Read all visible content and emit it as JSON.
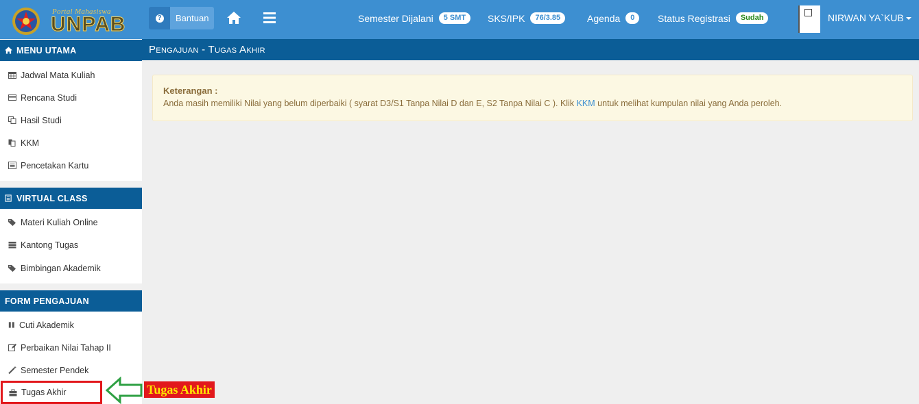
{
  "brand": {
    "small": "Portal Mahasiswa",
    "big": "UNPAB"
  },
  "header": {
    "help_label": "Bantuan",
    "semester_label": "Semester Dijalani",
    "semester_value": "5 SMT",
    "sks_label": "SKS/IPK",
    "sks_value": "76/3.85",
    "agenda_label": "Agenda",
    "agenda_value": "0",
    "registration_label": "Status Registrasi",
    "registration_value": "Sudah",
    "user_name": "NIRWAN YA`KUB"
  },
  "sidebar": {
    "menu_utama": {
      "title": "MENU UTAMA",
      "items": [
        {
          "label": "Jadwal Mata Kuliah",
          "icon": "calendar-icon"
        },
        {
          "label": "Rencana Studi",
          "icon": "credit-card-icon"
        },
        {
          "label": "Hasil Studi",
          "icon": "copy-icon"
        },
        {
          "label": "KKM",
          "icon": "documents-icon"
        },
        {
          "label": "Pencetakan Kartu",
          "icon": "list-alt-icon"
        }
      ]
    },
    "virtual_class": {
      "title": "VIRTUAL CLASS",
      "items": [
        {
          "label": "Materi Kuliah Online",
          "icon": "tags-icon"
        },
        {
          "label": "Kantong Tugas",
          "icon": "tasks-icon"
        },
        {
          "label": "Bimbingan Akademik",
          "icon": "tags-icon"
        }
      ]
    },
    "form_pengajuan": {
      "title": "FORM PENGAJUAN",
      "items": [
        {
          "label": "Cuti Akademik",
          "icon": "pause-icon"
        },
        {
          "label": "Perbaikan Nilai Tahap II",
          "icon": "edit-icon"
        },
        {
          "label": "Semester Pendek",
          "icon": "magic-wand-icon"
        },
        {
          "label": "Tugas Akhir",
          "icon": "briefcase-icon"
        }
      ]
    }
  },
  "page": {
    "title": "Pengajuan - Tugas Akhir"
  },
  "alert": {
    "title": "Keterangan :",
    "text_before": "Anda masih memiliki Nilai yang belum diperbaiki ( syarat D3/S1 Tanpa Nilai D dan E, S2 Tanpa Nilai C ). Klik ",
    "link": "KKM",
    "text_after": " untuk melihat kumpulan nilai yang Anda peroleh."
  },
  "annotation": {
    "label": "Tugas Akhir"
  },
  "colors": {
    "navbar": "#3d8fd1",
    "section_header": "#0b5d97",
    "alert_bg": "#fcf8e3",
    "alert_text": "#8a6d3b",
    "highlight": "#e2181c",
    "arrow": "#2ea043"
  }
}
